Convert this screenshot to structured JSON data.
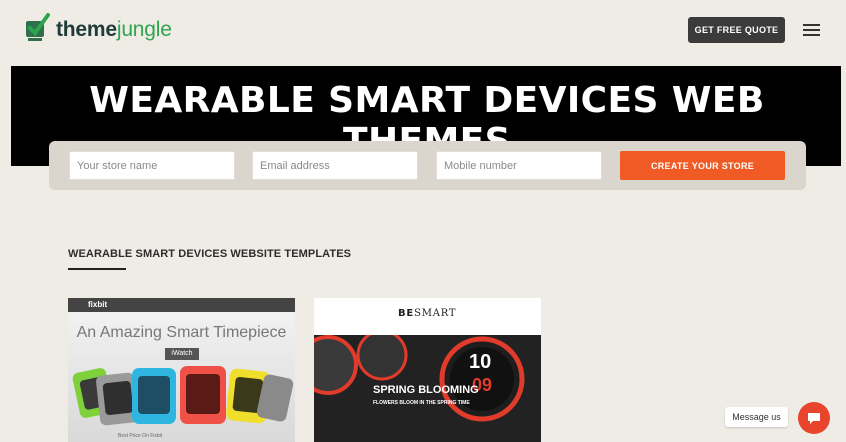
{
  "header": {
    "logo_text_dark": "theme",
    "logo_text_accent": "jungle",
    "quote_button": "GET FREE QUOTE"
  },
  "hero": {
    "title": "WEARABLE SMART DEVICES WEB THEMES"
  },
  "store_form": {
    "store_name_placeholder": "Your store name",
    "email_placeholder": "Email address",
    "mobile_placeholder": "Mobile number",
    "create_button": "CREATE YOUR STORE"
  },
  "section": {
    "title": "WEARABLE SMART DEVICES WEBSITE TEMPLATES"
  },
  "templates": [
    {
      "brand": "fixbit",
      "headline": "An Amazing Smart Timepiece",
      "tag": "iWatch",
      "caption": "Best Price On Fixbit"
    },
    {
      "brand_bold": "BE",
      "brand_rest": "SMART",
      "headline": "SPRING BLOOMING",
      "subheadline": "FLOWERS BLOOM IN THE SPRING TIME",
      "watch_hour": "10",
      "watch_minute": "09"
    }
  ],
  "chat": {
    "label": "Message us"
  },
  "colors": {
    "background": "#efece6",
    "hero": "#000000",
    "accent_orange": "#f05a24",
    "brand_green": "#2ea44f",
    "chat_red": "#e8452c"
  }
}
